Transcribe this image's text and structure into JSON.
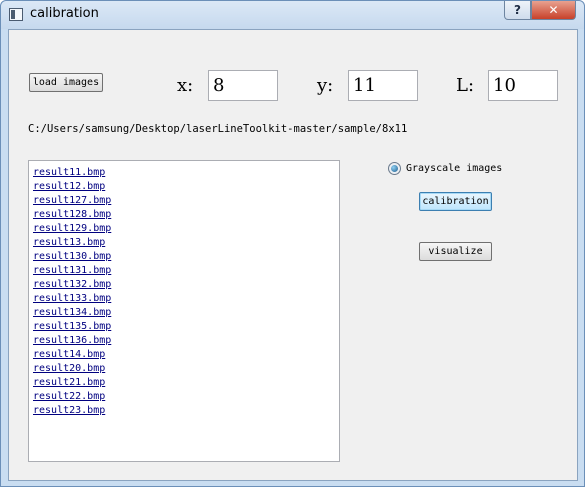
{
  "window": {
    "title": "calibration",
    "help_glyph": "?",
    "close_glyph": "✕"
  },
  "toolbar": {
    "load_images_label": "load images"
  },
  "params": {
    "x_label": "x:",
    "x_value": "8",
    "y_label": "y:",
    "y_value": "11",
    "l_label": "L:",
    "l_value": "10"
  },
  "path": "C:/Users/samsung/Desktop/laserLineToolkit-master/sample/8x11",
  "files": [
    "result11.bmp",
    "result12.bmp",
    "result127.bmp",
    "result128.bmp",
    "result129.bmp",
    "result13.bmp",
    "result130.bmp",
    "result131.bmp",
    "result132.bmp",
    "result133.bmp",
    "result134.bmp",
    "result135.bmp",
    "result136.bmp",
    "result14.bmp",
    "result20.bmp",
    "result21.bmp",
    "result22.bmp",
    "result23.bmp"
  ],
  "options": {
    "grayscale_label": "Grayscale images",
    "grayscale_checked": true
  },
  "actions": {
    "calibration_label": "calibration",
    "visualize_label": "visualize"
  }
}
